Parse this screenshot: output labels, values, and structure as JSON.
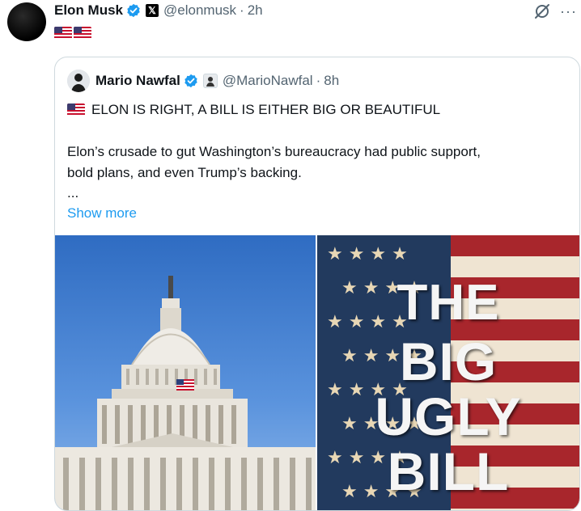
{
  "post": {
    "author_name": "Elon Musk",
    "handle": "@elonmusk",
    "separator": "·",
    "time": "2h",
    "flags_text": "🇺🇸🇺🇸"
  },
  "quote": {
    "author_name": "Mario Nawfal",
    "handle": "@MarioNawfal",
    "separator": "·",
    "time": "8h",
    "headline": "ELON IS RIGHT, A BILL IS EITHER BIG OR BEAUTIFUL",
    "body_line1": "Elon’s crusade to gut Washington’s bureaucracy had public support,",
    "body_line2": "bold plans, and even Trump’s backing.",
    "ellipsis": "...",
    "show_more": "Show more"
  },
  "media": {
    "right_lines": [
      "THE",
      "BIG",
      "UGLY",
      "BILL"
    ]
  },
  "colors": {
    "link": "#1d9bf0",
    "verified": "#1d9bf0",
    "secondary_text": "#536471"
  },
  "icons": {
    "verified": "verified-badge-icon",
    "x_badge": "x-logo-icon",
    "grok": "grok-icon",
    "more": "more-icon"
  }
}
